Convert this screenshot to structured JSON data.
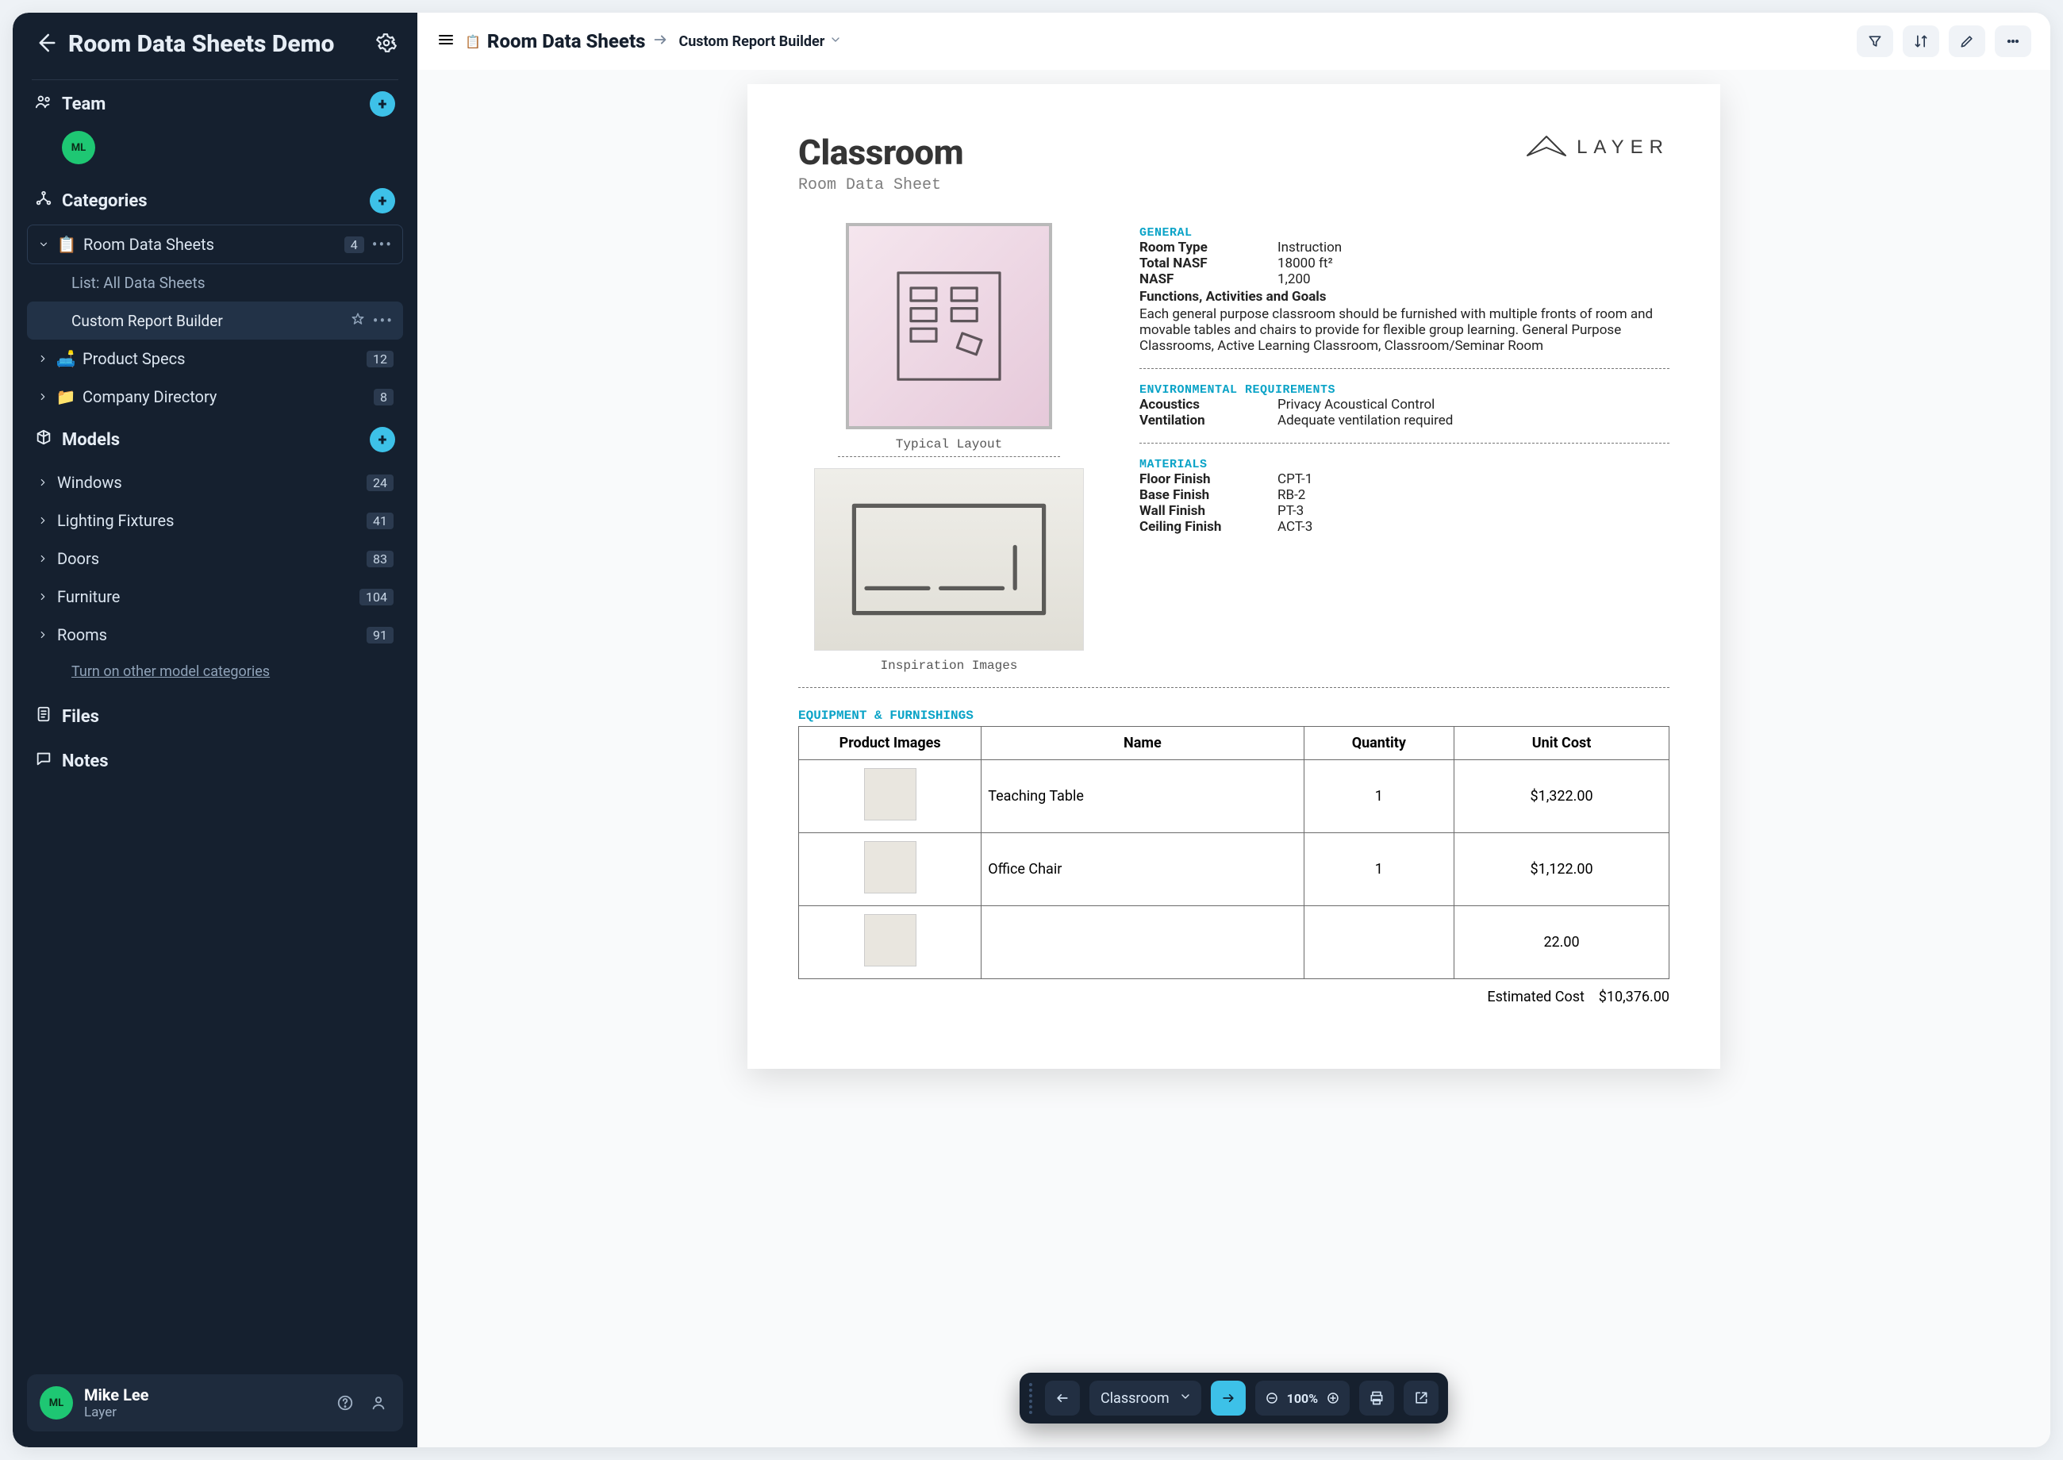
{
  "sidebar": {
    "title": "Room Data Sheets Demo",
    "sections": {
      "team": "Team",
      "categories": "Categories",
      "models": "Models",
      "files": "Files",
      "notes": "Notes"
    },
    "team_member_initials": "ML",
    "categories": [
      {
        "label": "Room Data Sheets",
        "count": "4",
        "expanded": true
      },
      {
        "label": "Product Specs",
        "count": "12"
      },
      {
        "label": "Company Directory",
        "count": "8"
      }
    ],
    "rds_children": [
      {
        "label": "List: All Data Sheets"
      },
      {
        "label": "Custom Report Builder",
        "active": true
      }
    ],
    "models": [
      {
        "label": "Windows",
        "count": "24"
      },
      {
        "label": "Lighting Fixtures",
        "count": "41"
      },
      {
        "label": "Doors",
        "count": "83"
      },
      {
        "label": "Furniture",
        "count": "104"
      },
      {
        "label": "Rooms",
        "count": "91"
      }
    ],
    "turn_on_link": "Turn on other model categories",
    "user": {
      "initials": "ML",
      "name": "Mike Lee",
      "org": "Layer"
    }
  },
  "topbar": {
    "title": "Room Data Sheets",
    "crumb": "Custom Report Builder"
  },
  "report": {
    "title": "Classroom",
    "subtitle": "Room Data Sheet",
    "brand": "LAYER",
    "caption_layout": "Typical Layout",
    "caption_inspire": "Inspiration Images",
    "general": {
      "header": "GENERAL",
      "room_type_k": "Room Type",
      "room_type_v": "Instruction",
      "total_nasf_k": "Total NASF",
      "total_nasf_v": "18000 ft²",
      "nasf_k": "NASF",
      "nasf_v": "1,200",
      "functions_hdr": "Functions, Activities and Goals",
      "functions_body": "Each general purpose classroom should be furnished with multiple fronts of room and movable tables and chairs to provide for flexible group learning. General Purpose Classrooms, Active Learning Classroom, Classroom/Seminar Room"
    },
    "env": {
      "header": "ENVIRONMENTAL REQUIREMENTS",
      "acoustics_k": "Acoustics",
      "acoustics_v": "Privacy Acoustical Control",
      "vent_k": "Ventilation",
      "vent_v": "Adequate ventilation required"
    },
    "materials": {
      "header": "MATERIALS",
      "floor_k": "Floor Finish",
      "floor_v": "CPT-1",
      "base_k": "Base Finish",
      "base_v": "RB-2",
      "wall_k": "Wall Finish",
      "wall_v": "PT-3",
      "ceil_k": "Ceiling Finish",
      "ceil_v": "ACT-3"
    },
    "equip": {
      "header": "EQUIPMENT & FURNISHINGS",
      "th_img": "Product Images",
      "th_name": "Name",
      "th_qty": "Quantity",
      "th_cost": "Unit Cost",
      "rows": [
        {
          "name": "Teaching Table",
          "qty": "1",
          "cost": "$1,322.00"
        },
        {
          "name": "Office Chair",
          "qty": "1",
          "cost": "$1,122.00"
        },
        {
          "name": "",
          "qty": "",
          "cost": "22.00"
        }
      ],
      "est_label": "Estimated Cost",
      "est_value": "$10,376.00"
    }
  },
  "floatbar": {
    "selected": "Classroom",
    "zoom": "100%"
  }
}
